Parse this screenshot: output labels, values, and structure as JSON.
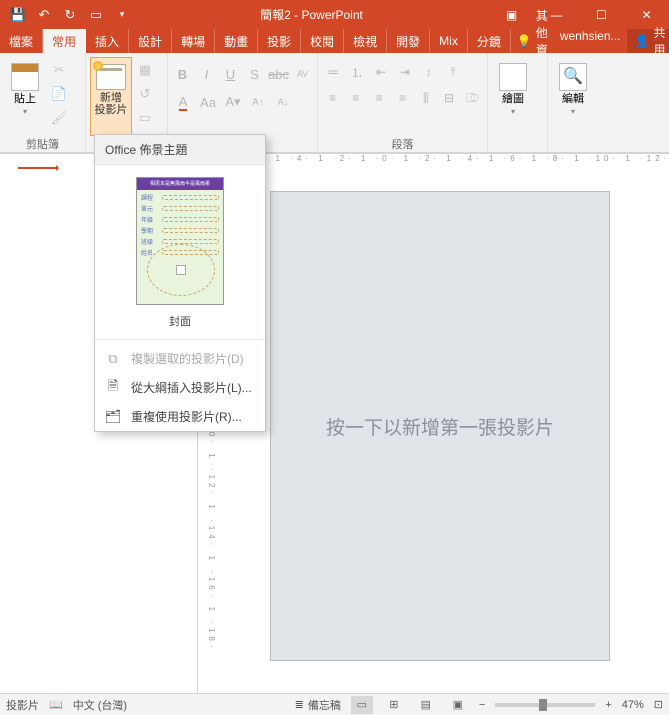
{
  "titlebar": {
    "title": "簡報2 - PowerPoint"
  },
  "qat": {
    "save": "save",
    "undo": "undo",
    "redo": "redo",
    "start": "start"
  },
  "tabs": {
    "file": "檔案",
    "home": "常用",
    "insert": "插入",
    "design": "設計",
    "transitions": "轉場",
    "animations": "動畫",
    "slideshow": "投影",
    "review": "校閱",
    "view": "檢視",
    "developer": "開發",
    "mix": "Mix",
    "addin": "分鏡",
    "tell_me": "其他資訊",
    "user": "wenhsien...",
    "share": "共用"
  },
  "ribbon": {
    "clipboard": {
      "label": "剪貼簿",
      "paste": "貼上"
    },
    "slides": {
      "label": "",
      "new_slide": "新增\n投影片"
    },
    "font": {
      "label": ""
    },
    "paragraph": {
      "label": "段落"
    },
    "drawing": {
      "label": "繪圖"
    },
    "editing": {
      "label": "編輯"
    }
  },
  "dropdown": {
    "title": "Office 佈景主題",
    "thumb": {
      "bar": "相思本是無風雨半是風雨柔",
      "fields": [
        "課程",
        "單元",
        "年級",
        "學期",
        "班級",
        "姓名"
      ],
      "label": "封面"
    },
    "items": [
      {
        "label": "複製選取的投影片(D)",
        "enabled": false
      },
      {
        "label": "從大綱插入投影片(L)...",
        "enabled": true
      },
      {
        "label": "重複使用投影片(R)...",
        "enabled": true
      }
    ]
  },
  "rulerH_marks": "· 1 ·6· 1 ·4· 1 ·2· 1 ·0· 1 ·2· 1 ·4· 1 ·6· 1 ·8· 1 ·10· 1 ·12· 1",
  "rulerV_marks": "· 0 · 1 ·2· 1 ·4· 1 ·6· 1 ·8· 1 ·10· 1 ·12· 1 ·14· 1 ·16· 1 ·18·",
  "canvas": {
    "placeholder": "按一下以新增第一張投影片"
  },
  "status": {
    "slide": "投影片",
    "lang": "中文 (台灣)",
    "notes": "備忘稿",
    "zoom": "47%"
  }
}
